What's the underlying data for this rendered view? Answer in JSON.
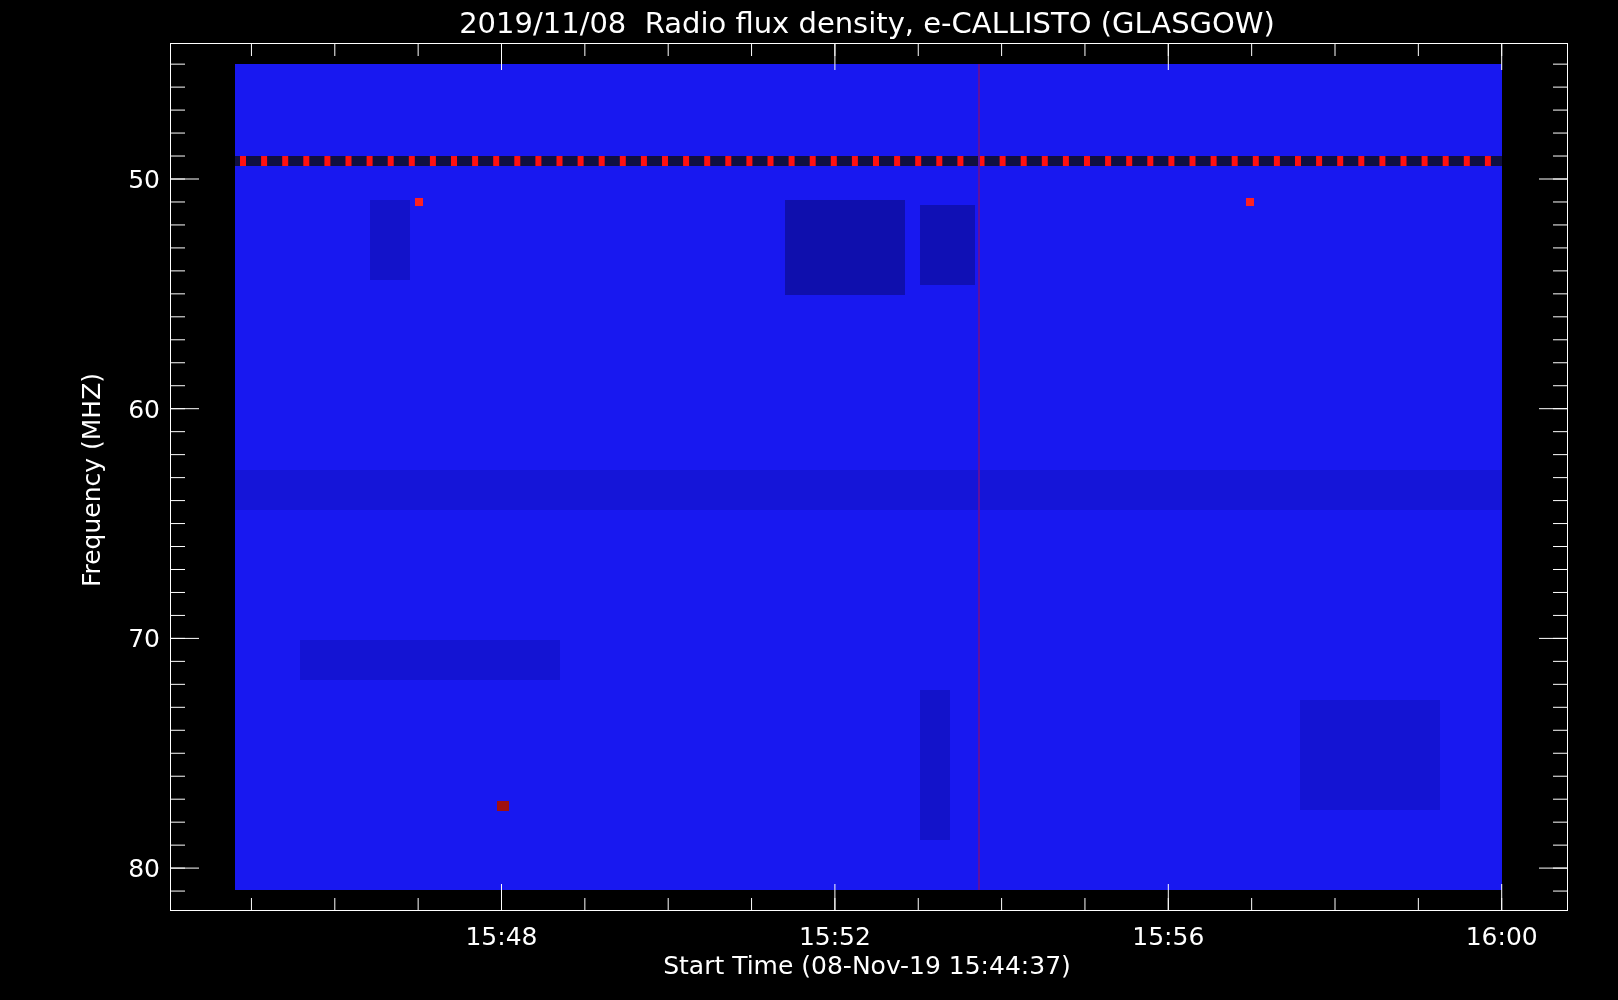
{
  "title": "2019/11/08  Radio flux density, e-CALLISTO (GLASGOW)",
  "y_axis": {
    "label": "Frequency (MHZ)",
    "ticks": [
      "50",
      "60",
      "70",
      "80"
    ]
  },
  "x_axis": {
    "label": "Start Time (08-Nov-19 15:44:37)",
    "ticks": [
      "15:48",
      "15:52",
      "15:56",
      "16:00"
    ]
  }
}
